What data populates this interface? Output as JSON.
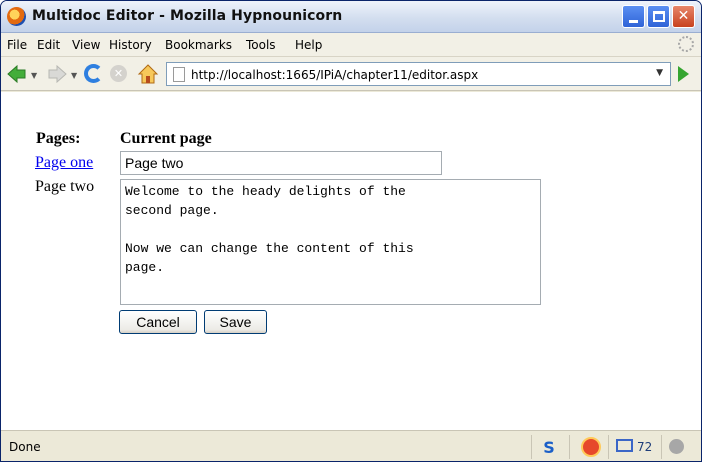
{
  "window": {
    "title": "Multidoc Editor - Mozilla Hypnounicorn"
  },
  "menubar": {
    "items": [
      {
        "label": "File",
        "mnemonic": "F"
      },
      {
        "label": "Edit",
        "mnemonic": "E"
      },
      {
        "label": "View",
        "mnemonic": "V"
      },
      {
        "label": "History",
        "mnemonic": "s"
      },
      {
        "label": "Bookmarks",
        "mnemonic": "B"
      },
      {
        "label": "Tools",
        "mnemonic": "T"
      },
      {
        "label": "Help",
        "mnemonic": "H"
      }
    ]
  },
  "navbar": {
    "url": "http://localhost:1665/IPiA/chapter11/editor.aspx"
  },
  "page": {
    "pages_heading": "Pages:",
    "current_heading": "Current page",
    "page_links": [
      {
        "label": "Page one",
        "is_link": true
      },
      {
        "label": "Page two",
        "is_link": false
      }
    ],
    "title_value": "Page two",
    "content_value": "Welcome to the heady delights of the\nsecond page.\n\nNow we can change the content of this\npage.",
    "cancel_label": "Cancel",
    "save_label": "Save"
  },
  "statusbar": {
    "text": "Done",
    "mail_count": "72",
    "s_label": "S"
  },
  "colors": {
    "link": "#0000ee",
    "titlebar_bg": "#d3deef",
    "close_button": "#c8421f",
    "go_arrow": "#36a530"
  }
}
